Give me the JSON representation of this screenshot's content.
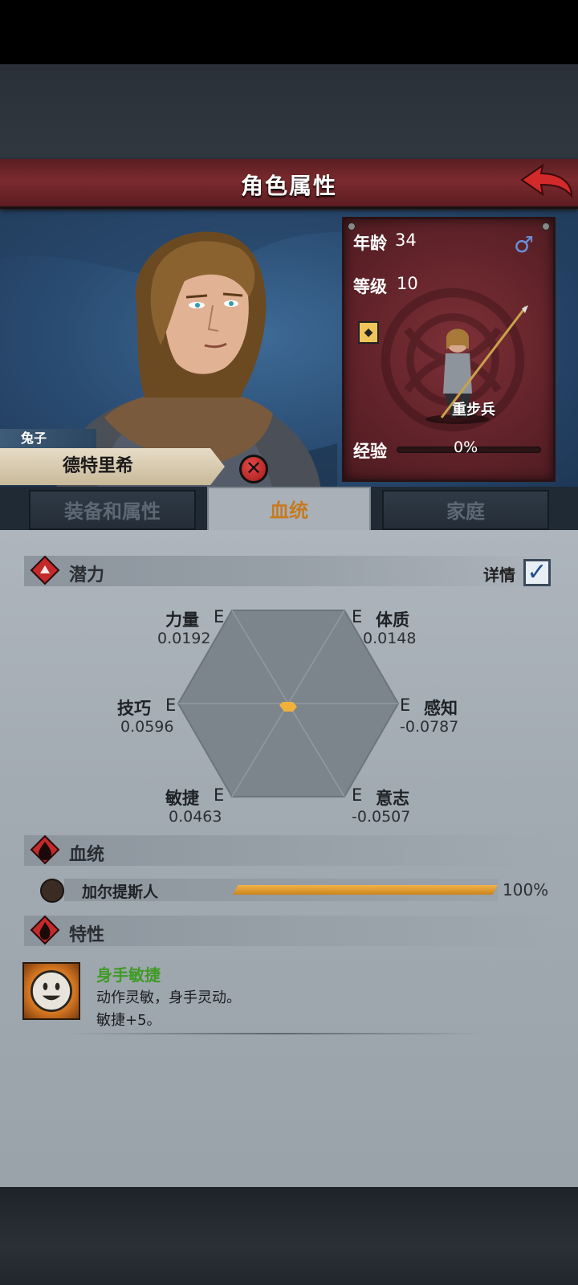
{
  "header": {
    "title": "角色属性"
  },
  "character": {
    "nickname": "兔子",
    "name": "德特里希",
    "age_label": "年龄",
    "age_value": "34",
    "level_label": "等级",
    "level_value": "10",
    "unit_type": "重步兵",
    "exp_label": "经验",
    "exp_value": "0%",
    "gender_icon": "♂"
  },
  "tabs": [
    {
      "label": "装备和属性"
    },
    {
      "label": "血统"
    },
    {
      "label": "家庭"
    }
  ],
  "potential": {
    "title": "潜力",
    "detail_label": "详情",
    "attributes": [
      {
        "name": "力量",
        "grade": "E",
        "value": "0.0192"
      },
      {
        "name": "体质",
        "grade": "E",
        "value": "0.0148"
      },
      {
        "name": "技巧",
        "grade": "E",
        "value": "0.0596"
      },
      {
        "name": "感知",
        "grade": "E",
        "value": "-0.0787"
      },
      {
        "name": "敏捷",
        "grade": "E",
        "value": "0.0463"
      },
      {
        "name": "意志",
        "grade": "E",
        "value": "-0.0507"
      }
    ]
  },
  "lineage": {
    "title": "血统",
    "items": [
      {
        "name": "加尔提斯人",
        "percent": "100%",
        "fraction": 1.0
      }
    ]
  },
  "traits": {
    "title": "特性",
    "items": [
      {
        "name": "身手敏捷",
        "description": "动作灵敏，身手灵动。",
        "effect": "敏捷+5。"
      }
    ]
  },
  "colors": {
    "title_bar": "#7a2a2e",
    "active_tab_text": "#c67a1f",
    "trait_name": "#3f9b25",
    "lineage_bar": "#f2b347"
  }
}
